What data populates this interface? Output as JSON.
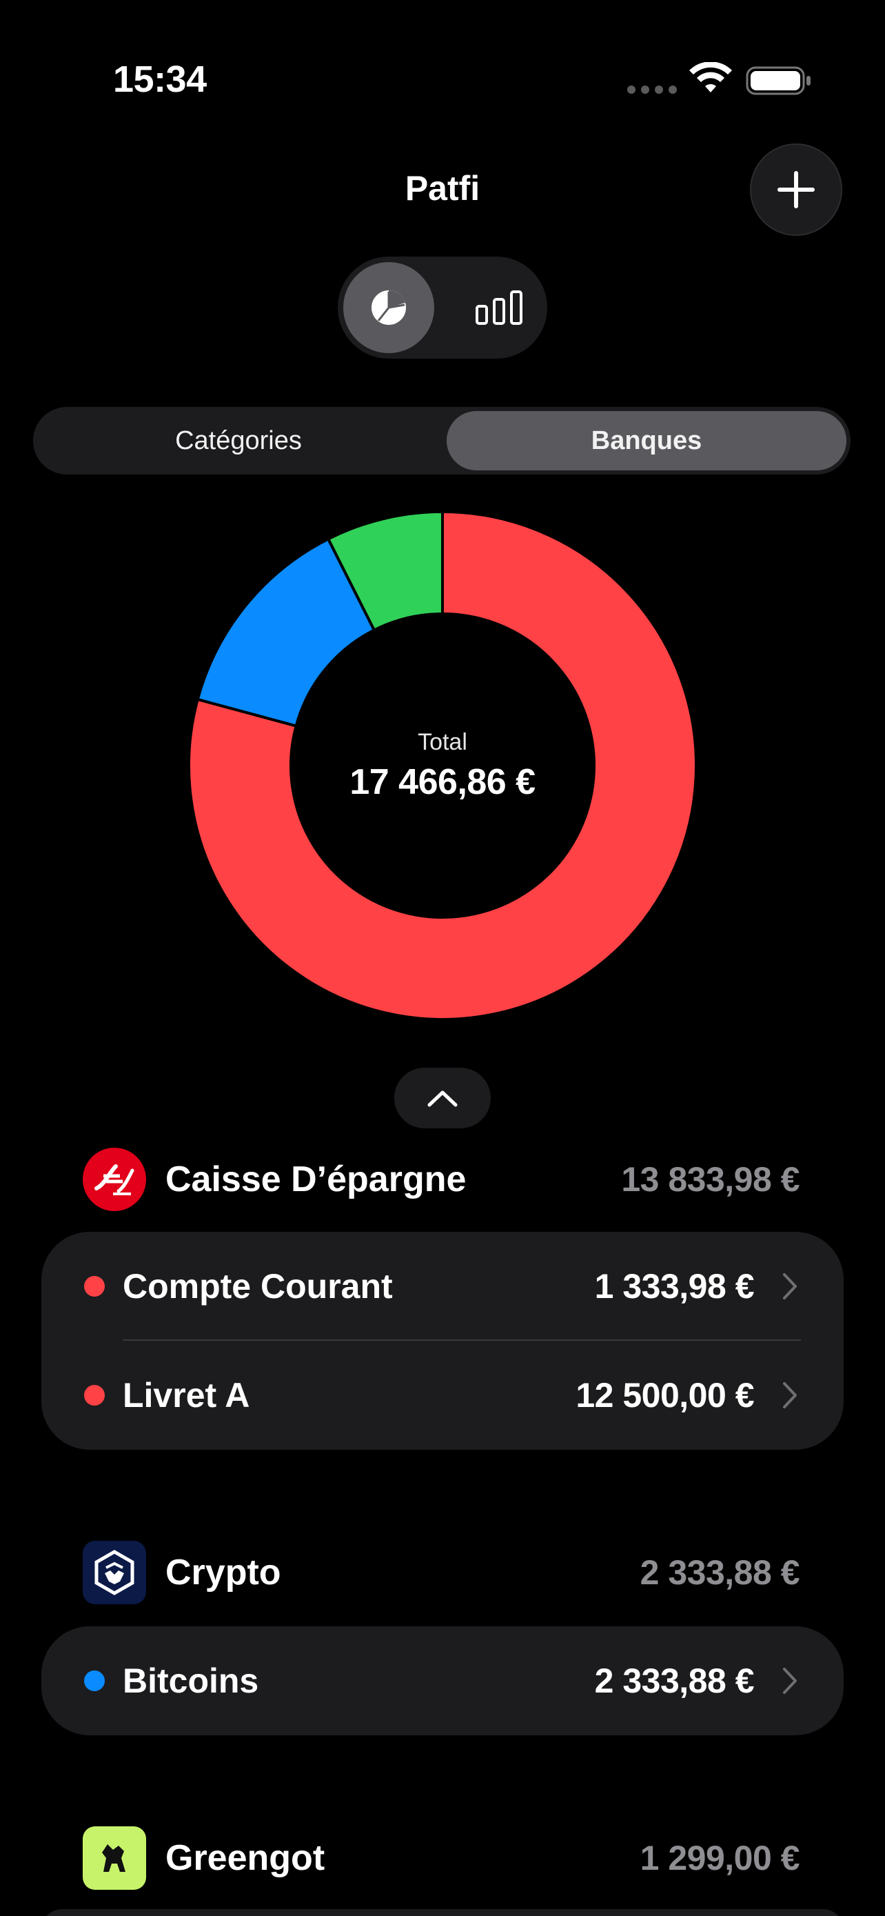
{
  "status_bar": {
    "time": "15:34"
  },
  "header": {
    "title": "Patfi"
  },
  "segments": {
    "left": "Catégories",
    "right": "Banques",
    "selected": "Banques"
  },
  "view_toggle": {
    "selected": "pie"
  },
  "donut": {
    "label": "Total",
    "total": "17 466,86 €",
    "colors": {
      "red": "#ff4245",
      "blue": "#0a8bff",
      "green": "#30d158"
    }
  },
  "chart_data": {
    "type": "pie",
    "style": "donut",
    "values": [
      13833.98,
      2333.88,
      1299.0
    ],
    "colors": [
      "#ff4245",
      "#0a8bff",
      "#30d158"
    ]
  },
  "banks": [
    {
      "name": "Caisse D’épargne",
      "total": "13 833,98 €",
      "logo_color": "#e2001a",
      "logo_icon": "caisse-epargne-logo",
      "accounts": [
        {
          "label": "Compte Courant",
          "value": "1 333,98 €",
          "dot_color": "#ff4245"
        },
        {
          "label": "Livret A",
          "value": "12 500,00 €",
          "dot_color": "#ff4245"
        }
      ]
    },
    {
      "name": "Crypto",
      "total": "2 333,88 €",
      "logo_color": "#0b1a47",
      "logo_icon": "crypto-com-logo",
      "accounts": [
        {
          "label": "Bitcoins",
          "value": "2 333,88 €",
          "dot_color": "#0a8bff"
        }
      ]
    },
    {
      "name": "Greengot",
      "total": "1 299,00 €",
      "logo_color": "#c7f36b",
      "logo_icon": "greengot-logo",
      "accounts": []
    }
  ]
}
